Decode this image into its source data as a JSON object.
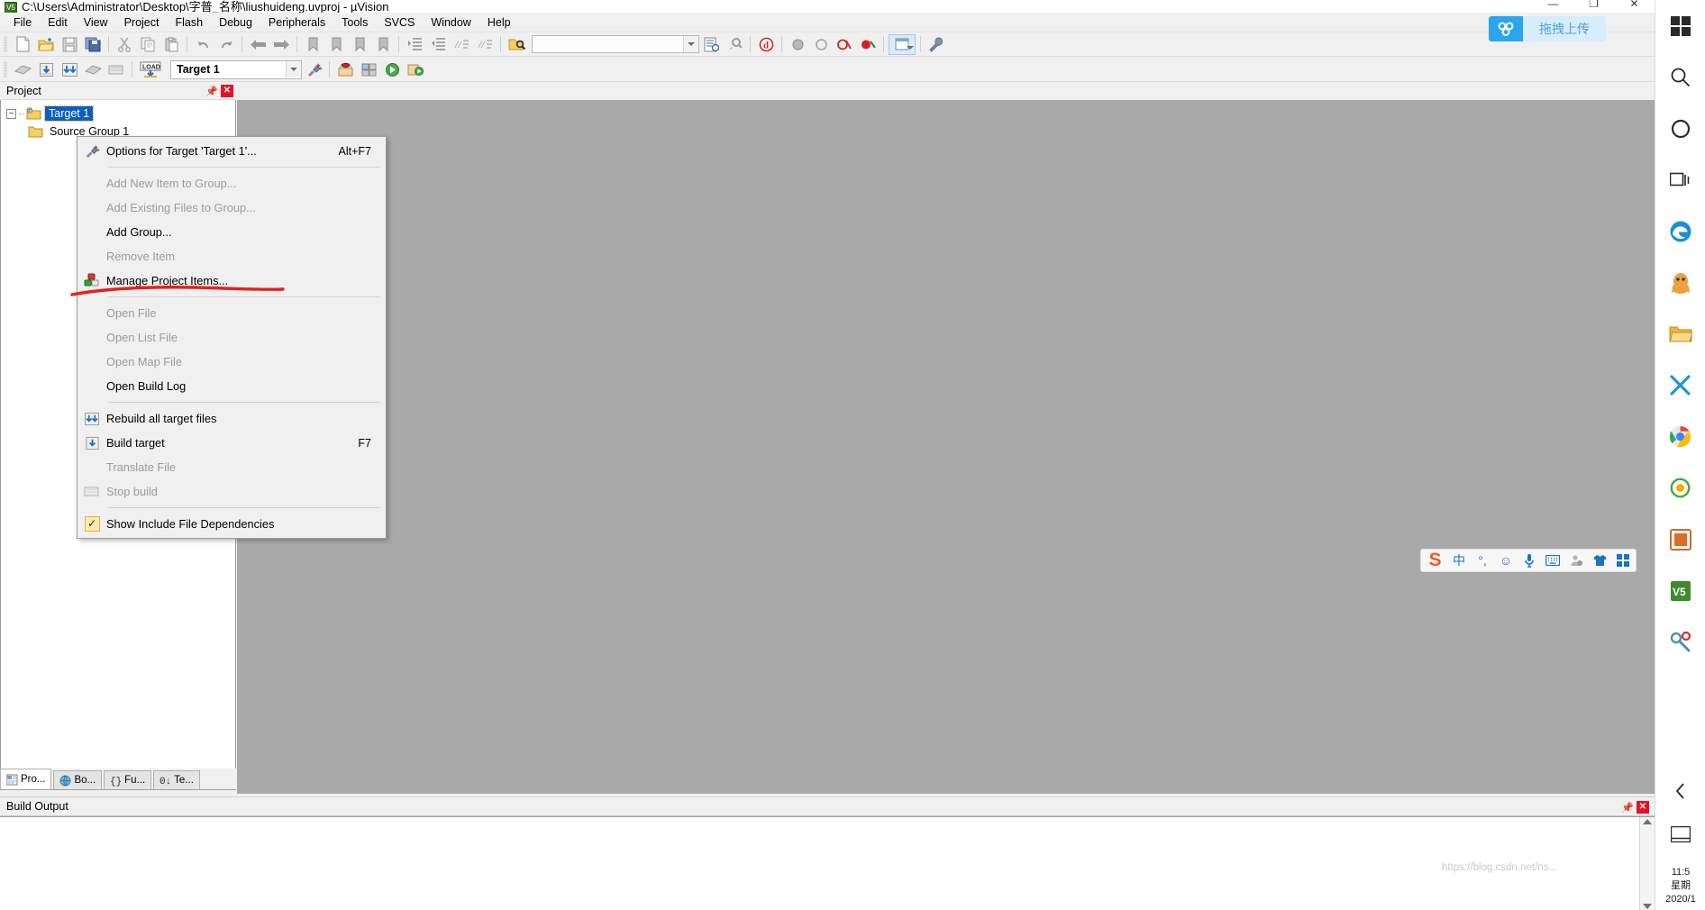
{
  "window": {
    "title": "C:\\Users\\Administrator\\Desktop\\字普_名称\\liushuideng.uvproj - µVision",
    "app_icon": "uvision-icon",
    "minimize_label": "—",
    "maximize_label": "❐",
    "close_label": "✕"
  },
  "menubar": {
    "items": [
      {
        "label": "File"
      },
      {
        "label": "Edit"
      },
      {
        "label": "View"
      },
      {
        "label": "Project"
      },
      {
        "label": "Flash"
      },
      {
        "label": "Debug"
      },
      {
        "label": "Peripherals"
      },
      {
        "label": "Tools"
      },
      {
        "label": "SVCS"
      },
      {
        "label": "Window"
      },
      {
        "label": "Help"
      }
    ]
  },
  "toolbar_main": {
    "find_placeholder": "",
    "find_value": "",
    "buttons": [
      {
        "name": "new-file-icon"
      },
      {
        "name": "open-file-icon"
      },
      {
        "name": "save-icon"
      },
      {
        "name": "save-all-icon"
      },
      {
        "name": "cut-icon"
      },
      {
        "name": "copy-icon"
      },
      {
        "name": "paste-icon"
      },
      {
        "name": "undo-icon"
      },
      {
        "name": "redo-icon"
      },
      {
        "name": "navigate-back-icon"
      },
      {
        "name": "navigate-forward-icon"
      },
      {
        "name": "bookmark-toggle-icon"
      },
      {
        "name": "bookmark-prev-icon"
      },
      {
        "name": "bookmark-next-icon"
      },
      {
        "name": "bookmark-clear-icon"
      },
      {
        "name": "indent-icon"
      },
      {
        "name": "outdent-icon"
      },
      {
        "name": "comment-icon"
      },
      {
        "name": "uncomment-icon"
      },
      {
        "name": "find-in-files-icon"
      },
      {
        "name": "bookmark-list-icon"
      },
      {
        "name": "configuration-icon"
      },
      {
        "name": "debug-stop-icon"
      },
      {
        "name": "breakpoint-icon"
      },
      {
        "name": "breakpoint-disable-icon"
      },
      {
        "name": "breakpoint-kill-all-icon"
      },
      {
        "name": "breakpoint-disable-all-icon"
      },
      {
        "name": "window-layout-icon"
      },
      {
        "name": "settings-wrench-icon"
      }
    ]
  },
  "toolbar_build": {
    "target_value": "Target 1",
    "buttons": [
      {
        "name": "translate-file-icon"
      },
      {
        "name": "build-target-icon"
      },
      {
        "name": "rebuild-all-icon"
      },
      {
        "name": "batch-build-icon"
      },
      {
        "name": "stop-build-icon"
      },
      {
        "name": "download-to-flash-icon"
      },
      {
        "name": "manage-components-icon"
      },
      {
        "name": "target-options-icon"
      },
      {
        "name": "pack-installer-icon"
      },
      {
        "name": "run-to-main-icon"
      },
      {
        "name": "start-debug-icon"
      }
    ]
  },
  "project_panel": {
    "title": "Project",
    "pin_icon": "pin-icon",
    "close_icon": "close-icon",
    "tree": {
      "root": {
        "label": "Target 1",
        "icon": "target-folder-icon",
        "selected": true
      },
      "child": {
        "label": "Source Group 1",
        "icon": "group-folder-icon",
        "selected": false
      }
    },
    "tabs": [
      {
        "label": "Pro...",
        "icon": "project-tab-icon",
        "active": true
      },
      {
        "label": "Bo...",
        "icon": "books-tab-icon",
        "active": false
      },
      {
        "label": "Fu...",
        "icon": "functions-tab-icon",
        "active": false
      },
      {
        "label": "Te...",
        "icon": "templates-tab-icon",
        "active": false
      }
    ]
  },
  "context_menu": {
    "items": [
      {
        "label": "Options for Target 'Target 1'...",
        "accel": "Alt+F7",
        "enabled": true,
        "icon": "target-options-icon",
        "checkbox": false
      },
      {
        "separator": true
      },
      {
        "label": "Add New Item to Group...",
        "accel": "",
        "enabled": false,
        "icon": "",
        "checkbox": false
      },
      {
        "label": "Add Existing Files to Group...",
        "accel": "",
        "enabled": false,
        "icon": "",
        "checkbox": false
      },
      {
        "label": "Add Group...",
        "accel": "",
        "enabled": true,
        "icon": "",
        "checkbox": false
      },
      {
        "label": "Remove Item",
        "accel": "",
        "enabled": false,
        "icon": "",
        "checkbox": false
      },
      {
        "label": "Manage Project Items...",
        "accel": "",
        "enabled": true,
        "icon": "manage-items-icon",
        "checkbox": false
      },
      {
        "separator": true
      },
      {
        "label": "Open File",
        "accel": "",
        "enabled": false,
        "icon": "",
        "checkbox": false
      },
      {
        "label": "Open List File",
        "accel": "",
        "enabled": false,
        "icon": "",
        "checkbox": false
      },
      {
        "label": "Open Map File",
        "accel": "",
        "enabled": false,
        "icon": "",
        "checkbox": false
      },
      {
        "label": "Open Build Log",
        "accel": "",
        "enabled": true,
        "icon": "",
        "checkbox": false
      },
      {
        "separator": true
      },
      {
        "label": "Rebuild all target files",
        "accel": "",
        "enabled": true,
        "icon": "rebuild-all-icon",
        "checkbox": false
      },
      {
        "label": "Build target",
        "accel": "F7",
        "enabled": true,
        "icon": "build-target-icon",
        "checkbox": false
      },
      {
        "label": "Translate File",
        "accel": "",
        "enabled": false,
        "icon": "",
        "checkbox": false
      },
      {
        "label": "Stop build",
        "accel": "",
        "enabled": false,
        "icon": "stop-build-icon",
        "checkbox": false
      },
      {
        "separator": true
      },
      {
        "label": "Show Include File Dependencies",
        "accel": "",
        "enabled": true,
        "icon": "",
        "checkbox": true,
        "checked": "✓"
      }
    ]
  },
  "build_output": {
    "title": "Build Output",
    "pin_icon": "pin-icon",
    "close_icon": "close-icon",
    "content": ""
  },
  "annotation": {
    "color": "#e8201c",
    "target": "Manage Project Items..."
  },
  "upload_widget": {
    "label": "拖拽上传",
    "icon": "cloud-upload-icon",
    "accent": "#2aa6ef"
  },
  "ime_bar": {
    "logo": "S",
    "buttons": [
      {
        "label": "中",
        "name": "ime-language-toggle"
      },
      {
        "label": "°,",
        "name": "ime-punctuation-toggle"
      },
      {
        "label": "☺",
        "name": "ime-emoji"
      },
      {
        "label": "🎤",
        "name": "ime-voice-input"
      },
      {
        "label": "⌨",
        "name": "ime-soft-keyboard"
      },
      {
        "label": "👤",
        "name": "ime-user-account"
      },
      {
        "label": "👕",
        "name": "ime-skin"
      },
      {
        "label": "▦",
        "name": "ime-toolbox"
      }
    ]
  },
  "sidebar": {
    "items": [
      {
        "name": "windows-start-icon",
        "glyph": "⊞",
        "color": "#2a2a2a"
      },
      {
        "name": "search-icon",
        "glyph": "⌕",
        "color": "#2a2a2a"
      },
      {
        "name": "cortana-icon",
        "glyph": "◯",
        "color": "#2a2a2a"
      },
      {
        "name": "task-view-icon",
        "glyph": "❐",
        "color": "#2a2a2a"
      },
      {
        "name": "edge-browser-icon",
        "glyph": "◉",
        "color": "#1a8fd4"
      },
      {
        "name": "qq-icon",
        "glyph": "🐧",
        "color": "#e8a33d"
      },
      {
        "name": "file-explorer-icon",
        "glyph": "▰",
        "color": "#e8a33d"
      },
      {
        "name": "wechat-icon",
        "glyph": "✕",
        "color": "#2196d6"
      },
      {
        "name": "chrome-icon",
        "glyph": "◎",
        "color": "#34a853"
      },
      {
        "name": "browser-icon",
        "glyph": "◍",
        "color": "#4aa84a"
      },
      {
        "name": "photos-icon",
        "glyph": "▣",
        "color": "#e06a2a"
      },
      {
        "name": "uvision-icon",
        "glyph": "V5",
        "color": "#3f8a2a"
      },
      {
        "name": "tools-icon",
        "glyph": "⚙",
        "color": "#4a90c4"
      },
      {
        "name": "chevron-left-icon",
        "glyph": "‹",
        "color": "#2a2a2a"
      },
      {
        "name": "notification-icon",
        "glyph": "▭",
        "color": "#2a2a2a"
      }
    ],
    "clock": {
      "time": "11:5",
      "day": "星期",
      "date": "2020/1"
    }
  },
  "watermark": {
    "text": "https://blog.csdn.net/ns..."
  }
}
